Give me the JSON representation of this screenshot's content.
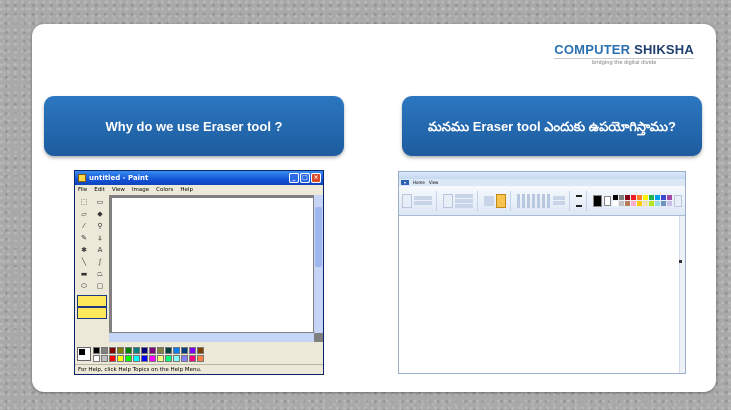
{
  "logo": {
    "part1": "COMPUTER",
    "part2": "SHIKSHA",
    "tagline": "bridging the digital divide"
  },
  "headings": {
    "english": "Why do we use Eraser tool ?",
    "telugu": "మనము Eraser tool ఎందుకు ఉపయోగిస్తాము?"
  },
  "xp_paint": {
    "title": "untitled - Paint",
    "menus": [
      "File",
      "Edit",
      "View",
      "Image",
      "Colors",
      "Help"
    ],
    "status": "For Help, click Help Topics on the Help Menu.",
    "palette": [
      "#000000",
      "#808080",
      "#800000",
      "#808000",
      "#008000",
      "#008080",
      "#000080",
      "#800080",
      "#808040",
      "#004040",
      "#0080ff",
      "#004080",
      "#8000ff",
      "#804000",
      "#ffffff",
      "#c0c0c0",
      "#ff0000",
      "#ffff00",
      "#00ff00",
      "#00ffff",
      "#0000ff",
      "#ff00ff",
      "#ffff80",
      "#00ff80",
      "#80ffff",
      "#8080ff",
      "#ff0080",
      "#ff8040"
    ]
  },
  "win7_paint": {
    "tabs": [
      "Home",
      "View"
    ],
    "palette": [
      "#000000",
      "#7f7f7f",
      "#880015",
      "#ed1c24",
      "#ff7f27",
      "#fff200",
      "#22b14c",
      "#00a2e8",
      "#3f48cc",
      "#a349a4",
      "#ffffff",
      "#c3c3c3",
      "#b97a57",
      "#ffaec9",
      "#ffc90e",
      "#efe4b0",
      "#b5e61d",
      "#99d9ea",
      "#7092be",
      "#c8bfe7"
    ]
  }
}
